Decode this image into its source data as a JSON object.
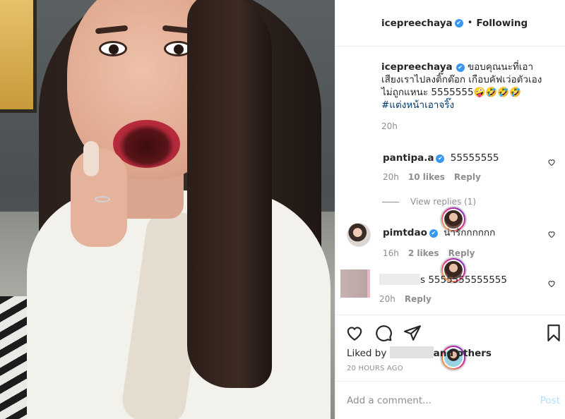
{
  "post": {
    "username": "icepreechaya",
    "follow_status": "Following",
    "separator": "•",
    "verified_mark": "✔"
  },
  "caption": {
    "username": "icepreechaya",
    "text": "ขอบคุณนะที่เอาเสียงเราไปลงติ๊กต๊อก เกือบคัฟเว่อตัวเองไม่ถูกแหนะ 5555555🤪🤣🤣🤣",
    "hashtag": "#แต่งหน้าเอาจริ๊ง",
    "time": "20h"
  },
  "comments": [
    {
      "username": "pantipa.a",
      "text": "55555555",
      "time": "20h",
      "likes": "10 likes",
      "reply": "Reply",
      "verified": true
    },
    {
      "username": "pimtdao",
      "text": "น่ารักกกกกก",
      "time": "16h",
      "likes": "2 likes",
      "reply": "Reply",
      "verified": true
    },
    {
      "username": "",
      "text": "s 5555555555555",
      "time": "20h",
      "likes": "",
      "reply": "Reply",
      "verified": false
    }
  ],
  "view_replies": "View replies (1)",
  "icons": {
    "like": "heart-icon",
    "comment": "comment-icon",
    "share": "share-icon",
    "save": "bookmark-icon",
    "comment_like": "heart-icon"
  },
  "liked_by": {
    "prefix": "Liked by",
    "suffix": "and others"
  },
  "timestamp": "20 HOURS AGO",
  "add_comment": {
    "placeholder": "Add a comment...",
    "post_label": "Post"
  },
  "colors": {
    "link": "#00376b",
    "verified": "#3897f0",
    "post_disabled": "#b2dffc",
    "muted": "#8e8e8e"
  }
}
